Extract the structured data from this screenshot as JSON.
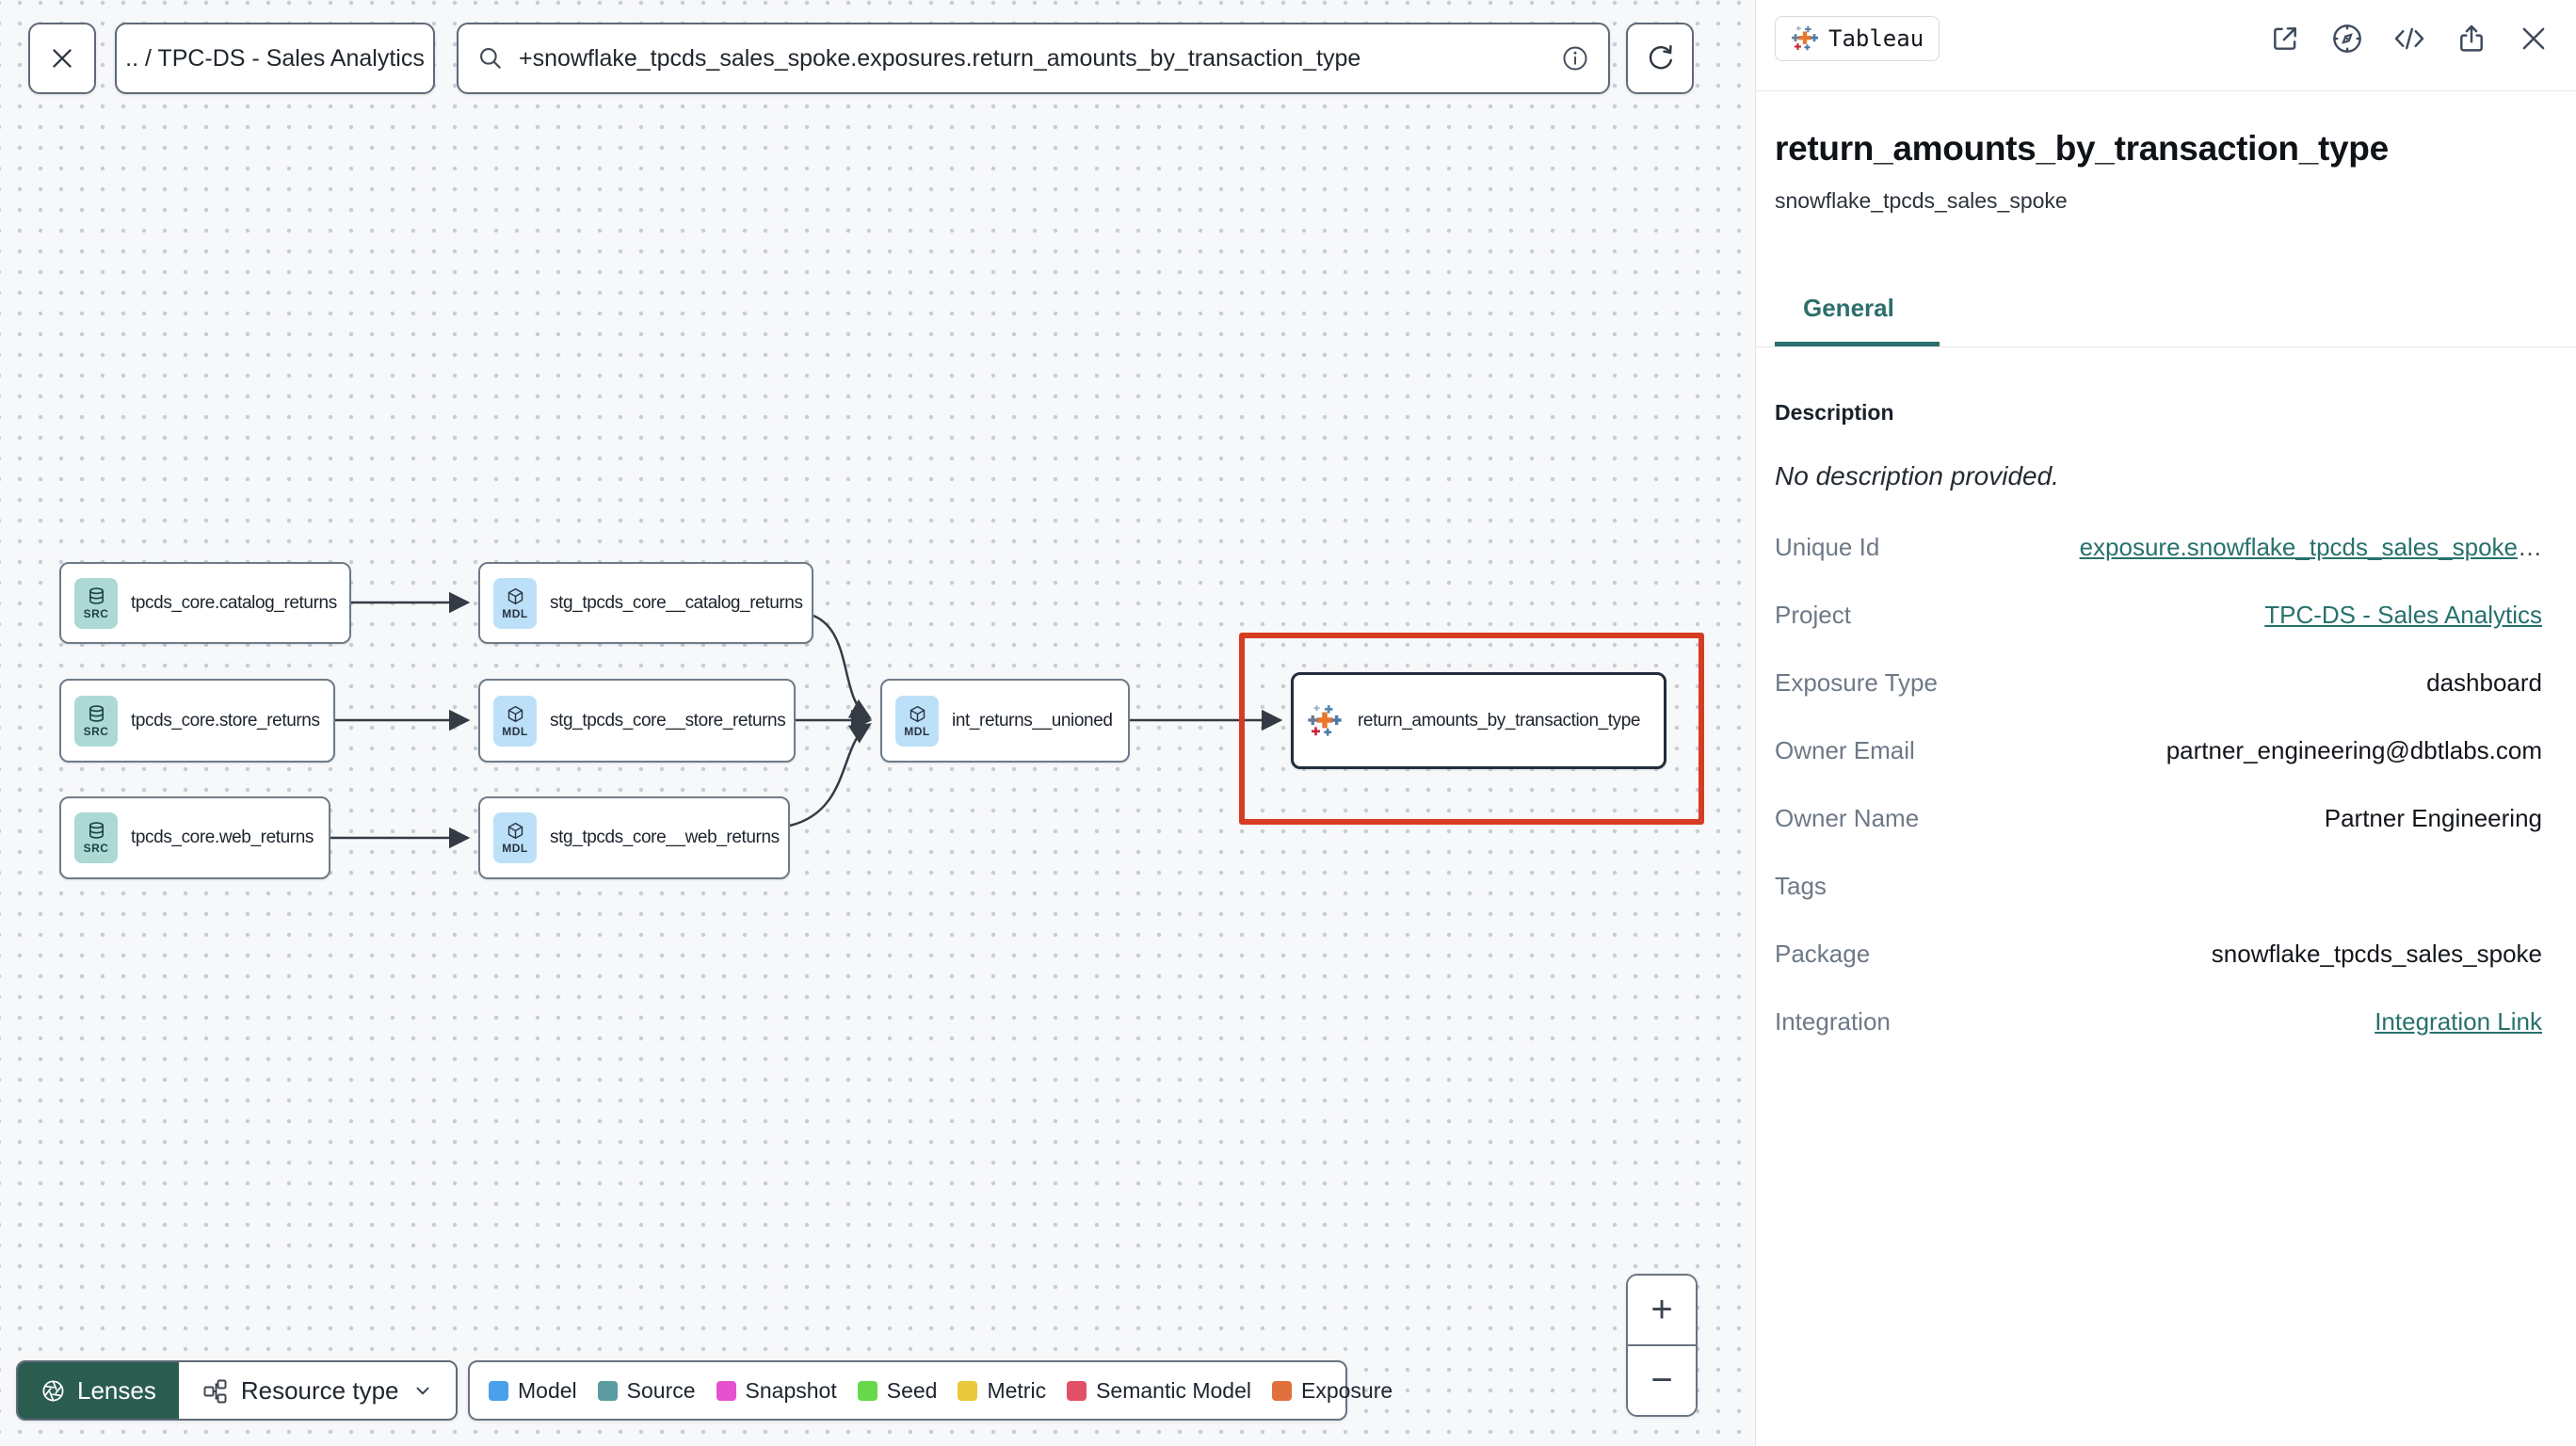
{
  "topbar": {
    "breadcrumb": ".. / TPC-DS - Sales Analytics",
    "search_value": "+snowflake_tpcds_sales_spoke.exposures.return_amounts_by_transaction_type"
  },
  "graph": {
    "nodes": [
      {
        "badge": "SRC",
        "label": "tpcds_core.catalog_returns"
      },
      {
        "badge": "SRC",
        "label": "tpcds_core.store_returns"
      },
      {
        "badge": "SRC",
        "label": "tpcds_core.web_returns"
      },
      {
        "badge": "MDL",
        "label": "stg_tpcds_core__catalog_returns"
      },
      {
        "badge": "MDL",
        "label": "stg_tpcds_core__store_returns"
      },
      {
        "badge": "MDL",
        "label": "stg_tpcds_core__web_returns"
      },
      {
        "badge": "MDL",
        "label": "int_returns__unioned"
      },
      {
        "badge": "tableau",
        "label": "return_amounts_by_transaction_type"
      }
    ]
  },
  "toolbar": {
    "lenses_label": "Lenses",
    "resource_type_label": "Resource type"
  },
  "legend": {
    "items": [
      {
        "label": "Model",
        "color": "#4aa0eb"
      },
      {
        "label": "Source",
        "color": "#5b9ca0"
      },
      {
        "label": "Snapshot",
        "color": "#e651cf"
      },
      {
        "label": "Seed",
        "color": "#66d94a"
      },
      {
        "label": "Metric",
        "color": "#e8c83d"
      },
      {
        "label": "Semantic Model",
        "color": "#e25066"
      },
      {
        "label": "Exposure",
        "color": "#e0703c"
      }
    ]
  },
  "zoom_controls": {
    "zoom_in": "+",
    "zoom_out": "−"
  },
  "panel": {
    "integration_badge": "Tableau",
    "title": "return_amounts_by_transaction_type",
    "subtitle": "snowflake_tpcds_sales_spoke",
    "tab": "General",
    "description_label": "Description",
    "description_value": "No description provided.",
    "fields": [
      {
        "label": "Unique Id",
        "value": "exposure.snowflake_tpcds_sales_spoke",
        "ellipsis": "…"
      },
      {
        "label": "Project",
        "value": "TPC-DS - Sales Analytics"
      },
      {
        "label": "Exposure Type",
        "value": "dashboard"
      },
      {
        "label": "Owner Email",
        "value": "partner_engineering@dbtlabs.com"
      },
      {
        "label": "Owner Name",
        "value": "Partner Engineering"
      },
      {
        "label": "Tags",
        "value": ""
      },
      {
        "label": "Package",
        "value": "snowflake_tpcds_sales_spoke"
      },
      {
        "label": "Integration",
        "value": "Integration Link"
      }
    ]
  }
}
